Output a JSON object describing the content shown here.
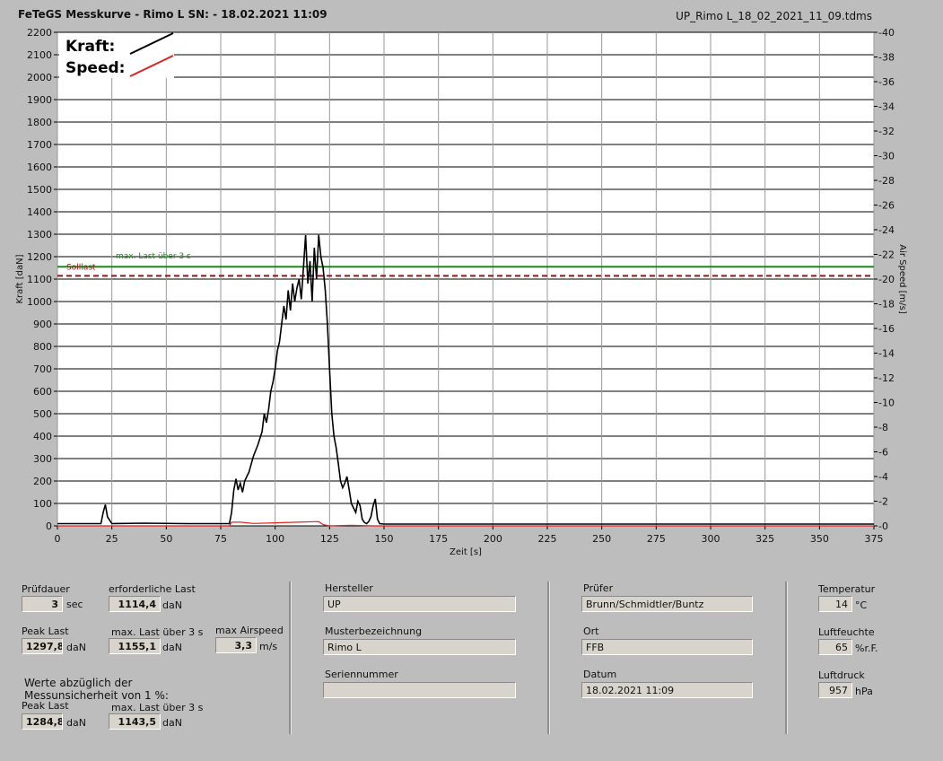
{
  "header": {
    "title": "FeTeGS Messkurve - Rimo L  SN:  - 18.02.2021 11:09",
    "filename": "UP_Rimo L_18_02_2021_11_09.tdms"
  },
  "legend": {
    "kraft": "Kraft:",
    "speed": "Speed:"
  },
  "chart_data": {
    "type": "line",
    "xlabel": "Zeit [s]",
    "ylabel": "Kraft [daN]",
    "y2label": "Air Speed [m/s]",
    "xlim": [
      0,
      375
    ],
    "ylim": [
      0,
      2200
    ],
    "y2lim": [
      0,
      40
    ],
    "x_ticks": [
      0,
      25,
      50,
      75,
      100,
      125,
      150,
      175,
      200,
      225,
      250,
      275,
      300,
      325,
      350,
      375
    ],
    "y_ticks": [
      0,
      100,
      200,
      300,
      400,
      500,
      600,
      700,
      800,
      900,
      1000,
      1100,
      1200,
      1300,
      1400,
      1500,
      1600,
      1700,
      1800,
      1900,
      2000,
      2100,
      2200
    ],
    "y2_ticks": [
      0,
      2,
      4,
      6,
      8,
      10,
      12,
      14,
      16,
      18,
      20,
      22,
      24,
      26,
      28,
      30,
      32,
      34,
      36,
      38,
      40
    ],
    "reference_lines": [
      {
        "name": "max. Last über  3 s",
        "value": 1155.1,
        "color": "#1a8a1a",
        "style": "solid"
      },
      {
        "name": "Solllast",
        "value": 1114.4,
        "color": "#9a1010",
        "style": "dashed"
      }
    ],
    "series": [
      {
        "name": "Kraft",
        "color": "#000000",
        "x": [
          0,
          20,
          21,
          22,
          23,
          25,
          40,
          60,
          79,
          80,
          81,
          82,
          83,
          84,
          85,
          86,
          88,
          90,
          92,
          94,
          95,
          96,
          97,
          98,
          99,
          100,
          101,
          102,
          103,
          104,
          105,
          106,
          107,
          108,
          109,
          110,
          111,
          112,
          113,
          114,
          115,
          116,
          117,
          118,
          119,
          120,
          121,
          122,
          123,
          124,
          125,
          126,
          127,
          128,
          129,
          130,
          131,
          132,
          133,
          134,
          135,
          136,
          137,
          138,
          139,
          140,
          141,
          142,
          143,
          144,
          145,
          146,
          147,
          148,
          150,
          200,
          300,
          375
        ],
        "y": [
          10,
          10,
          60,
          95,
          40,
          10,
          12,
          10,
          10,
          60,
          160,
          210,
          160,
          190,
          150,
          200,
          240,
          310,
          360,
          420,
          500,
          460,
          520,
          600,
          640,
          700,
          780,
          820,
          900,
          980,
          920,
          1050,
          960,
          1080,
          1000,
          1060,
          1100,
          1010,
          1150,
          1296,
          1080,
          1180,
          1000,
          1240,
          1100,
          1297,
          1200,
          1150,
          1050,
          900,
          700,
          500,
          400,
          350,
          280,
          200,
          170,
          190,
          220,
          160,
          100,
          80,
          60,
          110,
          90,
          30,
          15,
          10,
          20,
          40,
          90,
          120,
          30,
          10,
          8,
          8,
          8,
          8
        ]
      },
      {
        "name": "Speed",
        "color": "#e02020",
        "x": [
          0,
          79,
          80,
          84,
          90,
          100,
          110,
          120,
          122,
          125,
          135,
          145,
          150,
          375
        ],
        "y": [
          0,
          0,
          0.3,
          0.3,
          0.2,
          0.25,
          0.3,
          0.35,
          0.1,
          0,
          0.05,
          0,
          0,
          0
        ]
      }
    ]
  },
  "panel": {
    "pruefdauer": {
      "label": "Prüfdauer",
      "value": "3",
      "unit": "sec"
    },
    "erf_last": {
      "label": "erforderliche Last",
      "value": "1114,4",
      "unit": "daN"
    },
    "peak_last": {
      "label": "Peak Last",
      "value": "1297,8",
      "unit": "daN"
    },
    "max_last": {
      "label": "max. Last über  3 s",
      "value": "1155,1",
      "unit": "daN"
    },
    "max_airspeed": {
      "label": "max Airspeed",
      "value": "3,3",
      "unit": "m/s"
    },
    "werte_note_1": "Werte abzüglich der",
    "werte_note_2": "Messunsicherheit von 1  %:",
    "peak_last_2": {
      "label": "Peak Last",
      "value": "1284,8",
      "unit": "daN"
    },
    "max_last_2": {
      "label": "max. Last über  3 s",
      "value": "1143,5",
      "unit": "daN"
    },
    "hersteller": {
      "label": "Hersteller",
      "value": "UP"
    },
    "muster": {
      "label": "Musterbezeichnung",
      "value": "Rimo L"
    },
    "serien": {
      "label": "Seriennummer",
      "value": ""
    },
    "pruefer": {
      "label": "Prüfer",
      "value": "Brunn/Schmidtler/Buntz"
    },
    "ort": {
      "label": "Ort",
      "value": "FFB"
    },
    "datum": {
      "label": "Datum",
      "value": "18.02.2021 11:09"
    },
    "temperatur": {
      "label": "Temperatur",
      "value": "14",
      "unit": "°C"
    },
    "luftfeuchte": {
      "label": "Luftfeuchte",
      "value": "65",
      "unit": "%r.F."
    },
    "luftdruck": {
      "label": "Luftdruck",
      "value": "957",
      "unit": "hPa"
    }
  }
}
